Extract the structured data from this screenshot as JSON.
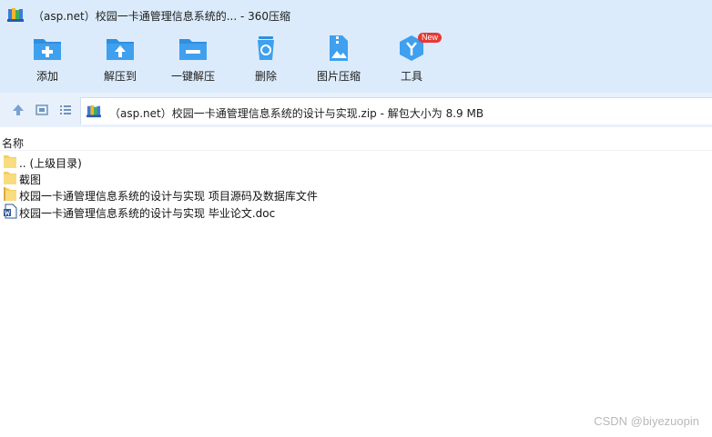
{
  "window": {
    "title": "（asp.net）校园一卡通管理信息系统的... - 360压缩",
    "app_icon": "archive-books-icon"
  },
  "toolbar": {
    "items": [
      {
        "label": "添加",
        "icon": "folder-add-icon"
      },
      {
        "label": "解压到",
        "icon": "folder-extract-icon"
      },
      {
        "label": "一键解压",
        "icon": "folder-one-click-extract-icon"
      },
      {
        "label": "删除",
        "icon": "recycle-bin-icon"
      },
      {
        "label": "图片压缩",
        "icon": "image-compress-icon"
      },
      {
        "label": "工具",
        "icon": "tools-cube-icon",
        "badge": "New"
      }
    ],
    "accent": "#2f8fe0"
  },
  "address": {
    "path": "（asp.net）校园一卡通管理信息系统的设计与实现.zip - 解包大小为 8.9 MB"
  },
  "list": {
    "header": "名称",
    "rows": [
      {
        "name": ".. (上级目录)",
        "icon": "folder-icon"
      },
      {
        "name": "截图",
        "icon": "folder-icon"
      },
      {
        "name": "校园一卡通管理信息系统的设计与实现 项目源码及数据库文件",
        "icon": "folder-icon"
      },
      {
        "name": "校园一卡通管理信息系统的设计与实现 毕业论文.doc",
        "icon": "word-doc-icon"
      }
    ]
  },
  "watermark": "CSDN @biyezuopin"
}
